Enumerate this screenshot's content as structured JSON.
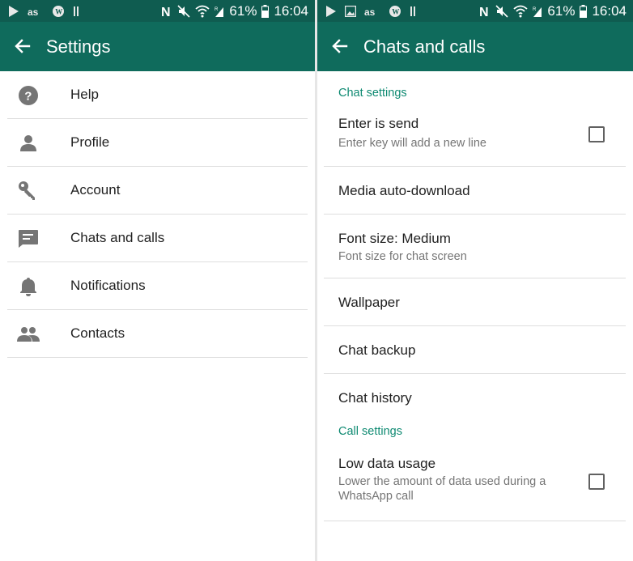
{
  "status_bar": {
    "battery": "61%",
    "time": "16:04",
    "left_icons": [
      "play-icon",
      "lastfm-icon",
      "wordpress-icon",
      "pause-bars-icon"
    ],
    "right_icons": [
      "nfc-icon",
      "mute-icon",
      "wifi-icon",
      "signal-icon",
      "battery-icon"
    ]
  },
  "left": {
    "title": "Settings",
    "items": [
      {
        "label": "Help",
        "icon": "help-icon"
      },
      {
        "label": "Profile",
        "icon": "person-icon"
      },
      {
        "label": "Account",
        "icon": "key-icon"
      },
      {
        "label": "Chats and calls",
        "icon": "chat-icon"
      },
      {
        "label": "Notifications",
        "icon": "bell-icon"
      },
      {
        "label": "Contacts",
        "icon": "contacts-icon"
      }
    ]
  },
  "right": {
    "title": "Chats and calls",
    "chat_settings_header": "Chat settings",
    "enter_is_send": {
      "title": "Enter is send",
      "subtitle": "Enter key will add a new line",
      "checked": false
    },
    "media_auto_download": "Media auto-download",
    "font_size": {
      "title": "Font size: Medium",
      "subtitle": "Font size for chat screen"
    },
    "wallpaper": "Wallpaper",
    "chat_backup": "Chat backup",
    "chat_history": "Chat history",
    "call_settings_header": "Call settings",
    "low_data_usage": {
      "title": "Low data usage",
      "subtitle_line1": "Lower the amount of data used during a",
      "subtitle_line2": "WhatsApp call",
      "checked": false
    }
  },
  "colors": {
    "status_bar": "#0f5c50",
    "app_bar": "#0f6b5c",
    "accent": "#0f8a72",
    "icon_gray": "#757575"
  }
}
